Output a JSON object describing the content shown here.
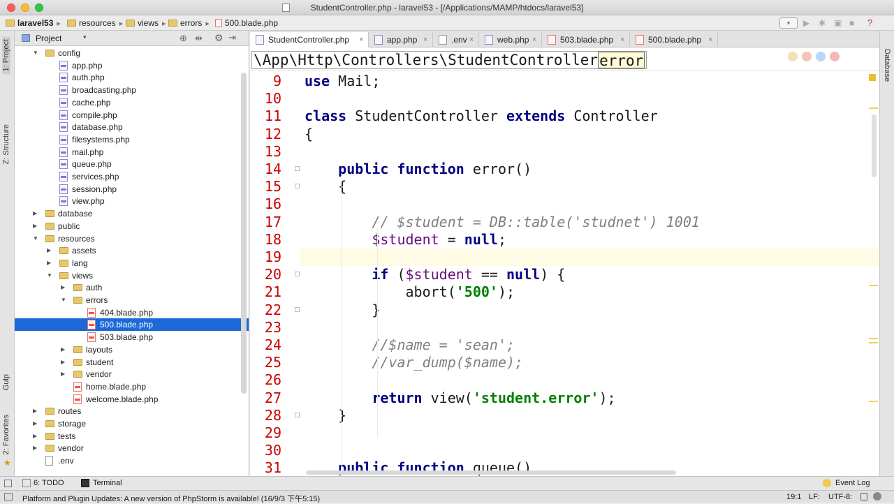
{
  "window": {
    "title": "StudentController.php - laravel53 - [/Applications/MAMP/htdocs/laravel53]"
  },
  "breadcrumb": [
    "laravel53",
    "resources",
    "views",
    "errors",
    "500.blade.php"
  ],
  "left_stripe": {
    "project": "1: Project",
    "structure": "Z: Structure",
    "gulp": "Gulp",
    "favorites": "2: Favorites"
  },
  "right_stripe": {
    "database": "Database"
  },
  "project_panel": {
    "title": "Project",
    "tree": [
      {
        "label": "config",
        "type": "folder",
        "depth": 1,
        "expanded": true
      },
      {
        "label": "app.php",
        "type": "php",
        "depth": 2
      },
      {
        "label": "auth.php",
        "type": "php",
        "depth": 2
      },
      {
        "label": "broadcasting.php",
        "type": "php",
        "depth": 2
      },
      {
        "label": "cache.php",
        "type": "php",
        "depth": 2
      },
      {
        "label": "compile.php",
        "type": "php",
        "depth": 2
      },
      {
        "label": "database.php",
        "type": "php",
        "depth": 2
      },
      {
        "label": "filesystems.php",
        "type": "php",
        "depth": 2
      },
      {
        "label": "mail.php",
        "type": "php",
        "depth": 2
      },
      {
        "label": "queue.php",
        "type": "php",
        "depth": 2
      },
      {
        "label": "services.php",
        "type": "php",
        "depth": 2
      },
      {
        "label": "session.php",
        "type": "php",
        "depth": 2
      },
      {
        "label": "view.php",
        "type": "php",
        "depth": 2
      },
      {
        "label": "database",
        "type": "folder",
        "depth": 1,
        "expanded": false
      },
      {
        "label": "public",
        "type": "folder",
        "depth": 1,
        "expanded": false
      },
      {
        "label": "resources",
        "type": "folder",
        "depth": 1,
        "expanded": true
      },
      {
        "label": "assets",
        "type": "folder",
        "depth": 2,
        "expanded": false
      },
      {
        "label": "lang",
        "type": "folder",
        "depth": 2,
        "expanded": false
      },
      {
        "label": "views",
        "type": "folder",
        "depth": 2,
        "expanded": true
      },
      {
        "label": "auth",
        "type": "folder",
        "depth": 3,
        "expanded": false
      },
      {
        "label": "errors",
        "type": "folder",
        "depth": 3,
        "expanded": true
      },
      {
        "label": "404.blade.php",
        "type": "blade",
        "depth": 4
      },
      {
        "label": "500.blade.php",
        "type": "blade",
        "depth": 4,
        "selected": true
      },
      {
        "label": "503.blade.php",
        "type": "blade",
        "depth": 4
      },
      {
        "label": "layouts",
        "type": "folder",
        "depth": 3,
        "expanded": false
      },
      {
        "label": "student",
        "type": "folder",
        "depth": 3,
        "expanded": false
      },
      {
        "label": "vendor",
        "type": "folder",
        "depth": 3,
        "expanded": false
      },
      {
        "label": "home.blade.php",
        "type": "blade",
        "depth": 3
      },
      {
        "label": "welcome.blade.php",
        "type": "blade",
        "depth": 3
      },
      {
        "label": "routes",
        "type": "folder",
        "depth": 1,
        "expanded": false
      },
      {
        "label": "storage",
        "type": "folder",
        "depth": 1,
        "expanded": false
      },
      {
        "label": "tests",
        "type": "folder",
        "depth": 1,
        "expanded": false
      },
      {
        "label": "vendor",
        "type": "folder",
        "depth": 1,
        "expanded": false
      },
      {
        "label": ".env",
        "type": "env",
        "depth": 1
      }
    ]
  },
  "editor_tabs": [
    {
      "label": "StudentController.php",
      "active": true
    },
    {
      "label": "app.php",
      "active": false
    },
    {
      "label": ".env",
      "active": false
    },
    {
      "label": "web.php",
      "active": false
    },
    {
      "label": "503.blade.php",
      "active": false
    },
    {
      "label": "500.blade.php",
      "active": false
    }
  ],
  "path_bar": {
    "namespace": "\\App\\Http\\Controllers\\StudentController",
    "method": "error"
  },
  "code_lines": [
    {
      "n": "9",
      "html": "<span class=\"kw\">use</span> Mail;"
    },
    {
      "n": "10",
      "html": ""
    },
    {
      "n": "11",
      "html": "<span class=\"kw\">class</span> StudentController <span class=\"kw\">extends</span> Controller"
    },
    {
      "n": "12",
      "html": "{"
    },
    {
      "n": "13",
      "html": ""
    },
    {
      "n": "14",
      "html": "    <span class=\"kw\">public function</span> error()"
    },
    {
      "n": "15",
      "html": "    {"
    },
    {
      "n": "16",
      "html": ""
    },
    {
      "n": "17",
      "html": "        <span class=\"cm\">// $student = DB::table('studnet') 1001</span>"
    },
    {
      "n": "18",
      "html": "        <span class=\"var\">$student</span> = <span class=\"kw\">null</span>;"
    },
    {
      "n": "19",
      "html": ""
    },
    {
      "n": "20",
      "html": "        <span class=\"kw\">if</span> (<span class=\"var\">$student</span> == <span class=\"kw\">null</span>) {"
    },
    {
      "n": "21",
      "html": "            abort(<span class=\"str\">'500'</span>);"
    },
    {
      "n": "22",
      "html": "        }"
    },
    {
      "n": "23",
      "html": ""
    },
    {
      "n": "24",
      "html": "        <span class=\"cm\">//$name = 'sean';</span>"
    },
    {
      "n": "25",
      "html": "        <span class=\"cm\">//var_dump($name);</span>"
    },
    {
      "n": "26",
      "html": ""
    },
    {
      "n": "27",
      "html": "        <span class=\"kw\">return</span> view(<span class=\"str\">'student.error'</span>);"
    },
    {
      "n": "28",
      "html": "    }"
    },
    {
      "n": "29",
      "html": ""
    },
    {
      "n": "30",
      "html": ""
    },
    {
      "n": "31",
      "html": "    <span class=\"kw\">public function</span> queue()"
    }
  ],
  "bottom_tools": {
    "todo": "6: TODO",
    "terminal": "Terminal",
    "event_log": "Event Log"
  },
  "status": {
    "message": "Platform and Plugin Updates: A new version of PhpStorm is available! (16/9/3 下午5:15)",
    "position": "19:1",
    "line_sep": "LF:",
    "encoding": "UTF-8:"
  },
  "colors": {
    "selection": "#1c68d6",
    "line_number": "#cc0000",
    "keyword": "#000080",
    "string": "#008000",
    "comment": "#808080"
  }
}
